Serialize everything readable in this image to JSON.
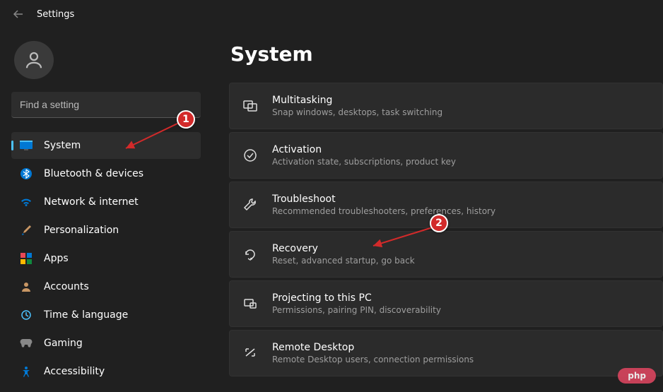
{
  "titlebar": {
    "title": "Settings"
  },
  "search": {
    "placeholder": "Find a setting"
  },
  "sidebar": {
    "items": [
      {
        "label": "System"
      },
      {
        "label": "Bluetooth & devices"
      },
      {
        "label": "Network & internet"
      },
      {
        "label": "Personalization"
      },
      {
        "label": "Apps"
      },
      {
        "label": "Accounts"
      },
      {
        "label": "Time & language"
      },
      {
        "label": "Gaming"
      },
      {
        "label": "Accessibility"
      }
    ]
  },
  "main": {
    "title": "System",
    "cards": [
      {
        "title": "Multitasking",
        "subtitle": "Snap windows, desktops, task switching"
      },
      {
        "title": "Activation",
        "subtitle": "Activation state, subscriptions, product key"
      },
      {
        "title": "Troubleshoot",
        "subtitle": "Recommended troubleshooters, preferences, history"
      },
      {
        "title": "Recovery",
        "subtitle": "Reset, advanced startup, go back"
      },
      {
        "title": "Projecting to this PC",
        "subtitle": "Permissions, pairing PIN, discoverability"
      },
      {
        "title": "Remote Desktop",
        "subtitle": "Remote Desktop users, connection permissions"
      }
    ]
  },
  "annotations": {
    "one": "1",
    "two": "2"
  },
  "watermark": "php"
}
